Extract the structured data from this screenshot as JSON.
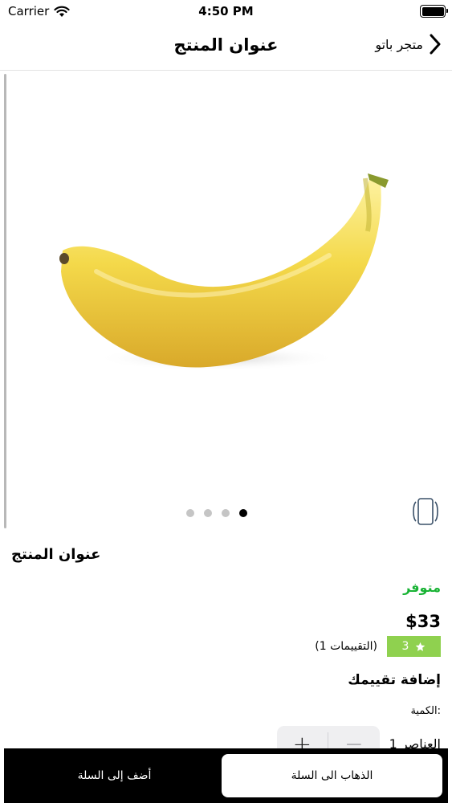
{
  "status_bar": {
    "carrier": "Carrier",
    "time": "4:50 PM"
  },
  "nav": {
    "title": "عنوان المنتج",
    "back_label": "متجر باتو"
  },
  "gallery": {
    "page_count": 4,
    "active_page": 4
  },
  "product": {
    "title": "عنوان المنتج",
    "availability": "متوفر",
    "price": "$33",
    "rating_value": "3",
    "rating_count": "(1 التقييمات)",
    "add_review": "إضافة تقييمك"
  },
  "quantity": {
    "label": "الكمية:",
    "value": "1 العناصر",
    "minus": "−",
    "plus": "+"
  },
  "actions": {
    "add_to_cart": "أضف إلى السلة",
    "go_to_cart": "الذهاب الى السلة"
  },
  "colors": {
    "available": "#18b334",
    "rating_badge": "#8fd14f",
    "action_bar": "#000000"
  }
}
